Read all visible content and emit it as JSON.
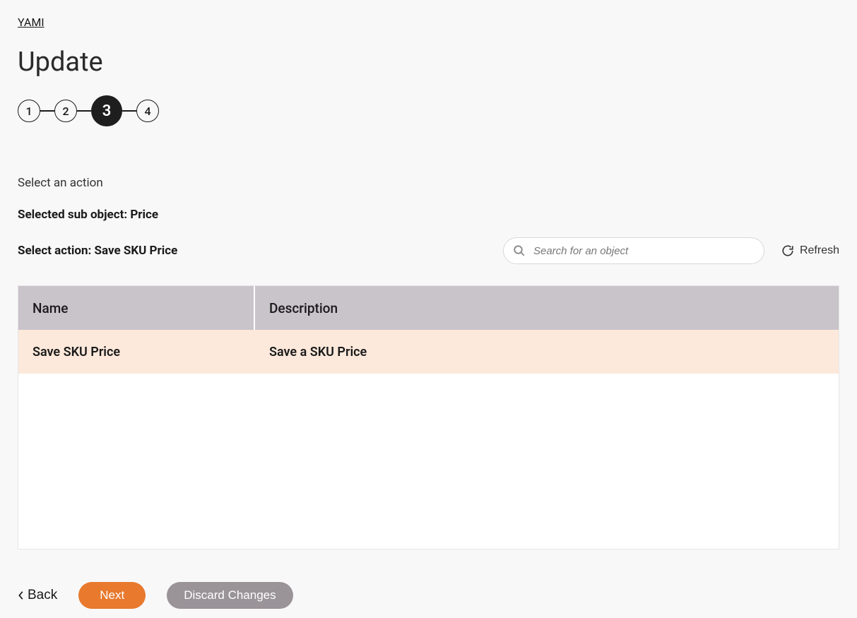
{
  "breadcrumb": "YAMI",
  "page_title": "Update",
  "stepper": {
    "steps": [
      "1",
      "2",
      "3",
      "4"
    ],
    "active_index": 2
  },
  "section_label": "Select an action",
  "selected_sub_label": "Selected sub object: Price",
  "select_action_label": "Select action: Save SKU Price",
  "search": {
    "placeholder": "Search for an object"
  },
  "refresh_label": "Refresh",
  "table": {
    "headers": {
      "name": "Name",
      "description": "Description"
    },
    "rows": [
      {
        "name": "Save SKU Price",
        "description": "Save a SKU Price"
      }
    ]
  },
  "footer": {
    "back": "Back",
    "next": "Next",
    "discard": "Discard Changes"
  }
}
